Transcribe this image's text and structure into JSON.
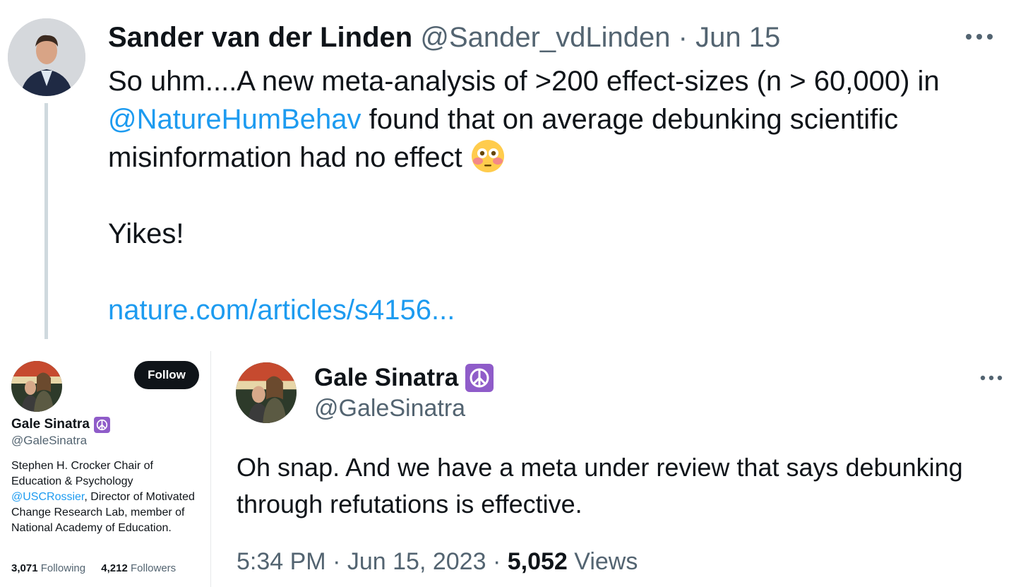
{
  "tweet_top": {
    "author_name": "Sander van der Linden",
    "author_handle": "@Sander_vdLinden",
    "separator": "·",
    "date": "Jun 15",
    "more_icon": "more-horizontal-icon",
    "text_part1": "So uhm....A new meta-analysis of >200 effect-sizes (n > 60,000) in ",
    "mention": "@NatureHumBehav",
    "text_part2": " found that on average debunking scientific misinformation had no effect ",
    "emoji": "flushed-face-emoji",
    "text_line2": "Yikes!",
    "link": "nature.com/articles/s4156..."
  },
  "profile_card": {
    "follow_label": "Follow",
    "name": "Gale Sinatra",
    "badge_icon": "peace-symbol-icon",
    "handle": "@GaleSinatra",
    "bio_part1": "Stephen H. Crocker Chair of Education & Psychology ",
    "bio_mention": "@USCRossier",
    "bio_part2": ", Director of Motivated Change Research Lab, member of National Academy of Education.",
    "following_count": "3,071",
    "following_label": "Following",
    "followers_count": "4,212",
    "followers_label": "Followers"
  },
  "tweet_main": {
    "author_name": "Gale Sinatra",
    "badge_icon": "peace-symbol-icon",
    "author_handle": "@GaleSinatra",
    "more_icon": "more-horizontal-icon",
    "text": "Oh snap. And we have a meta under review that says debunking through refutations is effective.",
    "time": "5:34 PM",
    "date": "Jun 15, 2023",
    "separator": "·",
    "views_count": "5,052",
    "views_label": "Views"
  },
  "colors": {
    "link": "#1d9bf0",
    "text": "#0f1419",
    "muted": "#536471",
    "badge": "#8f5cc9"
  }
}
